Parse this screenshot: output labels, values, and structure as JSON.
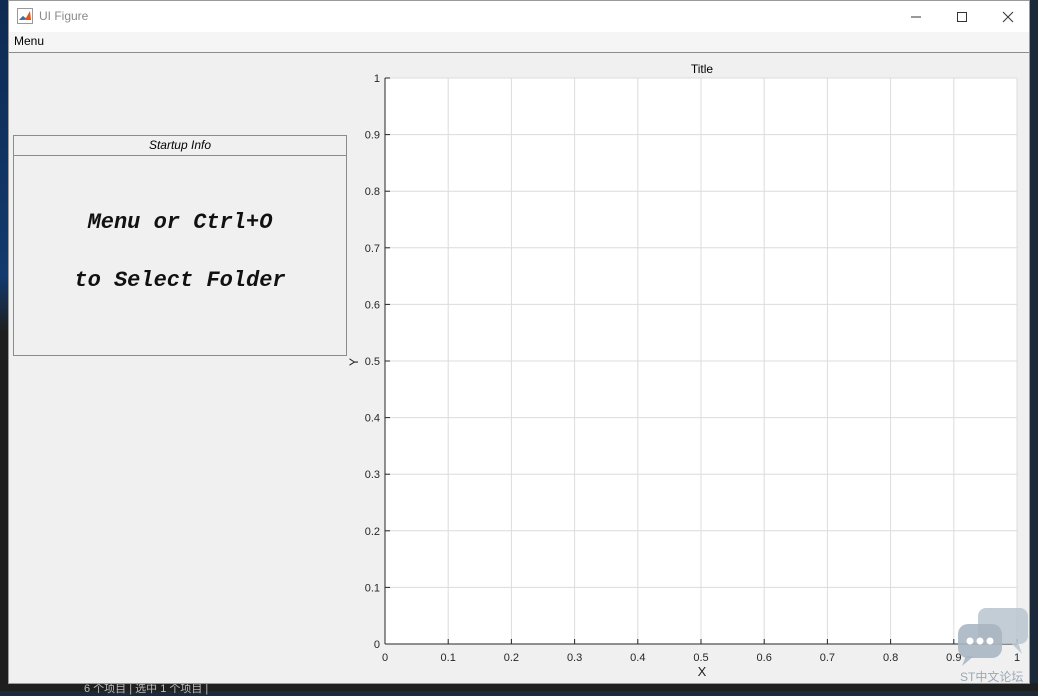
{
  "window": {
    "title": "UI Figure",
    "menu_label": "Menu"
  },
  "panel": {
    "title": "Startup Info",
    "line1": "Menu or Ctrl+O",
    "line2": "to Select Folder"
  },
  "axes": {
    "title": "Title",
    "xlabel": "X",
    "ylabel": "Y",
    "xticks": [
      "0",
      "0.1",
      "0.2",
      "0.3",
      "0.4",
      "0.5",
      "0.6",
      "0.7",
      "0.8",
      "0.9",
      "1"
    ],
    "yticks": [
      "0",
      "0.1",
      "0.2",
      "0.3",
      "0.4",
      "0.5",
      "0.6",
      "0.7",
      "0.8",
      "0.9",
      "1"
    ],
    "xlim": [
      0,
      1
    ],
    "ylim": [
      0,
      1
    ],
    "grid": true
  },
  "watermark": {
    "text": "ST中文论坛"
  },
  "taskbar_fragment": "6 个项目  |  选中 1 个项目  |"
}
